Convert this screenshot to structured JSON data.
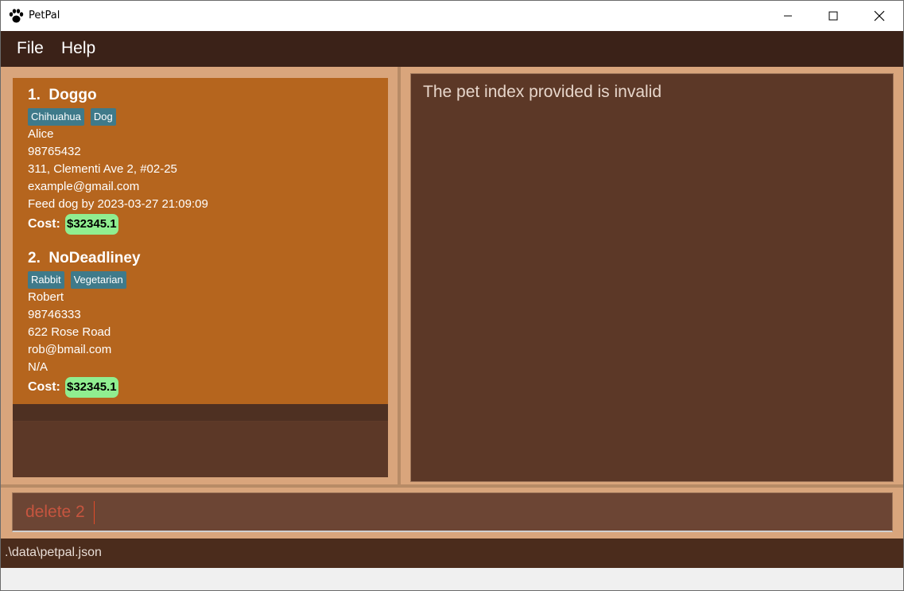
{
  "window": {
    "title": "PetPal"
  },
  "menu": {
    "items": [
      "File",
      "Help"
    ]
  },
  "pets": [
    {
      "index": "1.",
      "name": "Doggo",
      "tags": [
        "Chihuahua",
        "Dog"
      ],
      "owner": "Alice",
      "phone": "98765432",
      "address": "311, Clementi Ave 2, #02-25",
      "email": "example@gmail.com",
      "deadline": "Feed dog by 2023-03-27 21:09:09",
      "cost_label": "Cost:",
      "cost": "$32345.1"
    },
    {
      "index": "2.",
      "name": "NoDeadliney",
      "tags": [
        "Rabbit",
        "Vegetarian"
      ],
      "owner": "Robert",
      "phone": "98746333",
      "address": "622 Rose Road",
      "email": "rob@bmail.com",
      "deadline": "N/A",
      "cost_label": "Cost:",
      "cost": "$32345.1"
    }
  ],
  "result": {
    "message": "The pet index provided is invalid"
  },
  "command": {
    "value": "delete 2"
  },
  "status": {
    "file_path": ".\\data\\petpal.json"
  },
  "colors": {
    "menubar": "#3b2218",
    "card": "#b5651e",
    "tag": "#3f7a8a",
    "cost_badge": "#90ee90",
    "pane_bg": "#5c3827",
    "border": "#d9a57c"
  }
}
